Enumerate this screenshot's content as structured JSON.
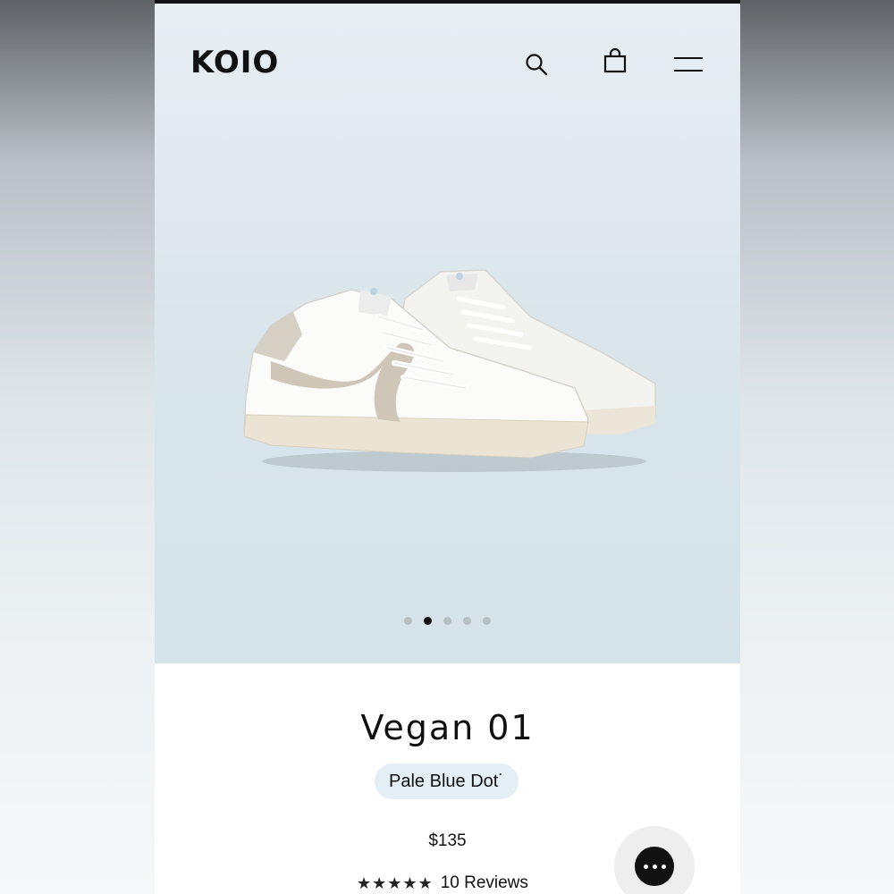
{
  "header": {
    "logo_text": "KOIO",
    "icons": [
      "search-icon",
      "shopping-bag-icon",
      "menu-icon"
    ]
  },
  "gallery": {
    "image_alt": "Vegan 01 sneaker pair",
    "slide_count": 5,
    "active_slide": 2
  },
  "product": {
    "title": "Vegan 01",
    "color_label": "Pale Blue Dot˙",
    "price": "$135",
    "rating_stars": "★★★★★",
    "rating_value": 5,
    "reviews_label": "10 Reviews"
  },
  "chat": {
    "icon": "chat-icon"
  },
  "colors": {
    "hero_bg": "#dce7ed",
    "pill_bg": "#e3eef5",
    "text": "#111111",
    "active_dot": "#111111",
    "inactive_dot": "#b4bec3"
  }
}
